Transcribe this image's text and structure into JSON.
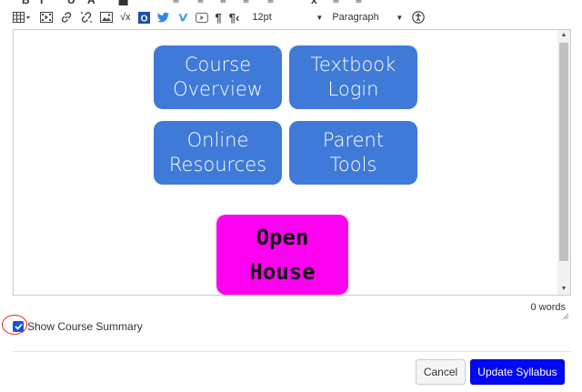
{
  "toolbar": {
    "font_size": "12pt",
    "block_format": "Paragraph",
    "icons": [
      "table-icon",
      "media-icon",
      "link-icon",
      "unlink-icon",
      "image-icon",
      "equation-icon",
      "office-icon",
      "twitter-icon",
      "vimeo-icon",
      "youtube-icon",
      "ltr-icon",
      "rtl-icon",
      "accessibility-icon"
    ]
  },
  "editor": {
    "tiles": [
      {
        "line1": "Course",
        "line2": "Overview"
      },
      {
        "line1": "Textbook",
        "line2": "Login"
      },
      {
        "line1": "Online",
        "line2": "Resources"
      },
      {
        "line1": "Parent",
        "line2": "Tools"
      }
    ],
    "open_house": {
      "line1": "Open",
      "line2": "House"
    },
    "word_count": "0 words"
  },
  "summary": {
    "label": "Show Course Summary",
    "checked": true
  },
  "actions": {
    "cancel_label": "Cancel",
    "update_label": "Update Syllabus"
  },
  "colors": {
    "tile_blue": "#3f7ad8",
    "open_house_magenta": "#ff00f0",
    "primary_button": "#0008f4",
    "annotation_red": "#e0201b"
  }
}
